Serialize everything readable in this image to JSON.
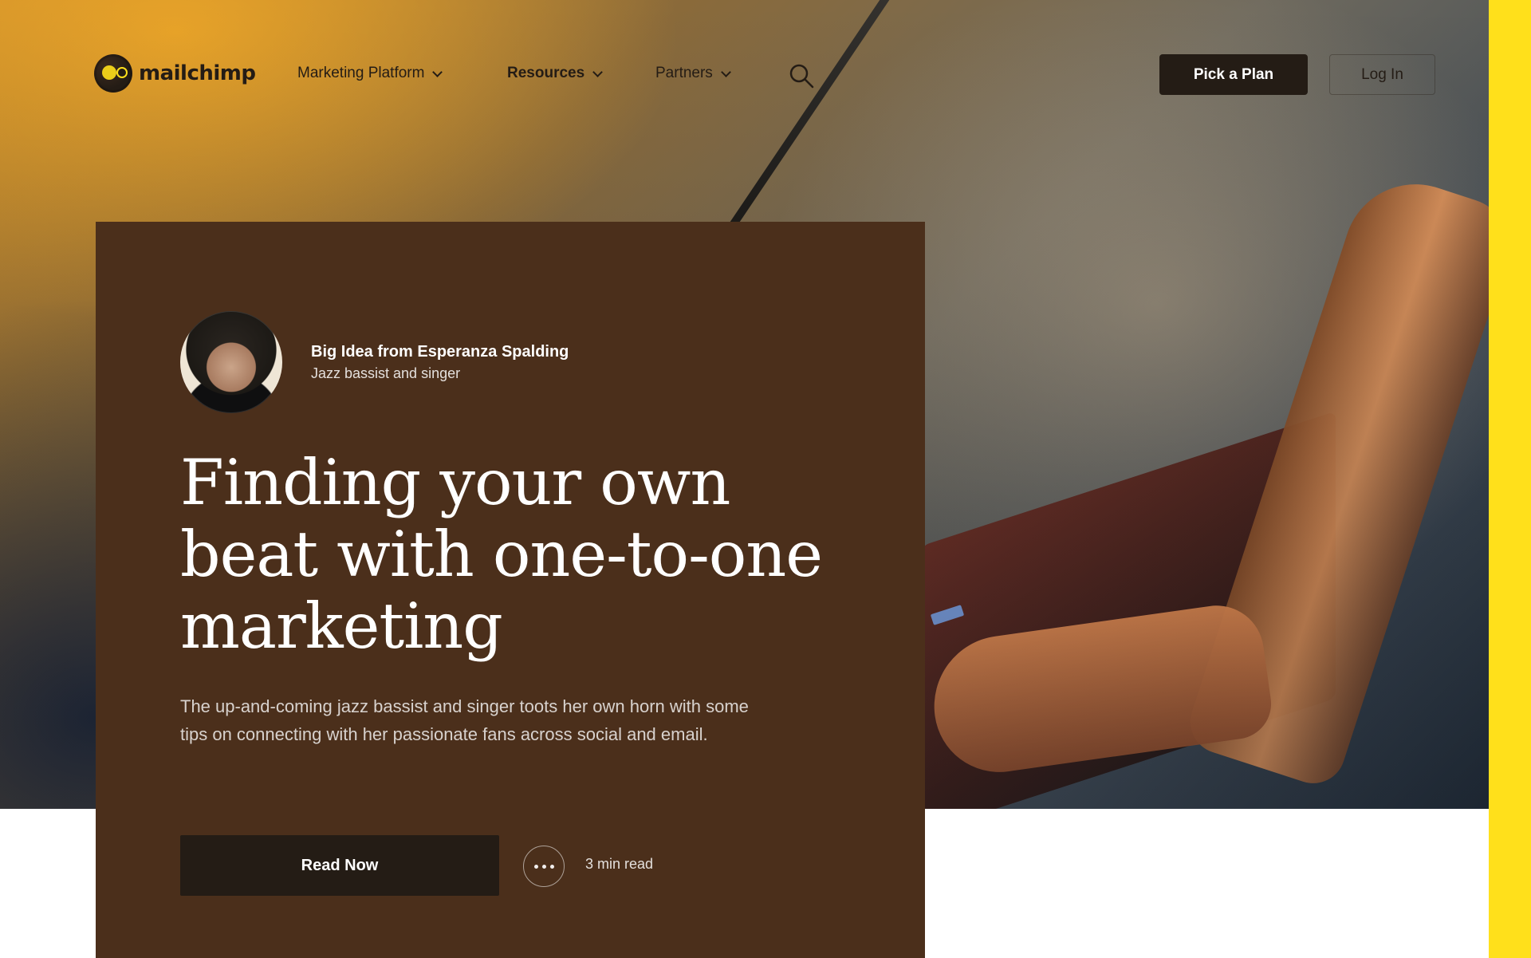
{
  "brand": {
    "logo_text": "mailchimp",
    "accent_yellow": "#ffe01b",
    "dark": "#241c15",
    "card_brown": "#4b2f1b"
  },
  "nav": {
    "items": [
      {
        "label": "Marketing Platform",
        "has_dropdown": true,
        "emphasis": "normal"
      },
      {
        "label": "Resources",
        "has_dropdown": true,
        "emphasis": "bold"
      },
      {
        "label": "Partners",
        "has_dropdown": true,
        "emphasis": "normal"
      }
    ],
    "search_icon": "search-icon",
    "cta_primary": "Pick a Plan",
    "cta_secondary": "Log In"
  },
  "feature": {
    "author": {
      "name": "Big Idea from Esperanza Spalding",
      "role": "Jazz bassist and singer",
      "avatar_icon": "avatar"
    },
    "headline": "Finding your own beat with one-to-one marketing",
    "excerpt": "The up-and-coming jazz bassist and singer toots her own horn with some tips on connecting with her passionate fans across social and email.",
    "primary_action": "Read Now",
    "more_icon": "more-horizontal-icon",
    "read_time": "3 min read"
  }
}
